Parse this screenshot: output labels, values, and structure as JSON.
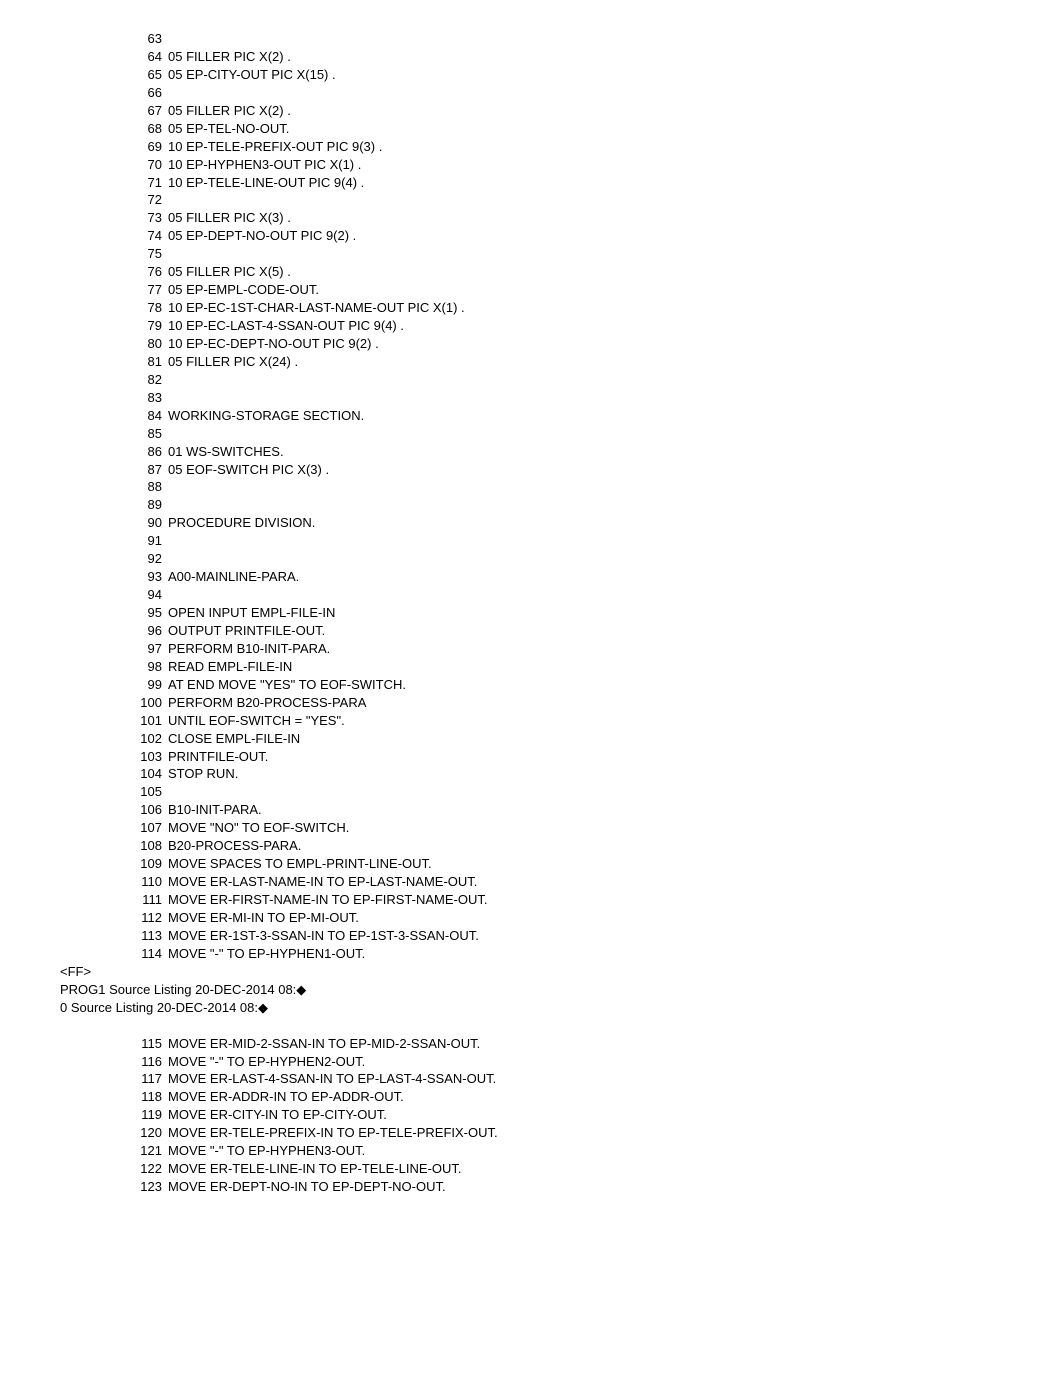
{
  "block1": [
    {
      "n": "63",
      "t": ""
    },
    {
      "n": "64",
      "t": "05 FILLER PIC X(2) ."
    },
    {
      "n": "65",
      "t": "05 EP-CITY-OUT PIC X(15) ."
    },
    {
      "n": "66",
      "t": ""
    },
    {
      "n": "67",
      "t": "05 FILLER PIC X(2) ."
    },
    {
      "n": "68",
      "t": "05 EP-TEL-NO-OUT."
    },
    {
      "n": "69",
      "t": "10 EP-TELE-PREFIX-OUT PIC 9(3) ."
    },
    {
      "n": "70",
      "t": "10 EP-HYPHEN3-OUT PIC X(1) ."
    },
    {
      "n": "71",
      "t": "10 EP-TELE-LINE-OUT PIC 9(4) ."
    },
    {
      "n": "72",
      "t": ""
    },
    {
      "n": "73",
      "t": "05 FILLER PIC X(3) ."
    },
    {
      "n": "74",
      "t": "05 EP-DEPT-NO-OUT PIC 9(2) ."
    },
    {
      "n": "75",
      "t": ""
    },
    {
      "n": "76",
      "t": "05 FILLER PIC X(5) ."
    },
    {
      "n": "77",
      "t": "05 EP-EMPL-CODE-OUT."
    },
    {
      "n": "78",
      "t": "10 EP-EC-1ST-CHAR-LAST-NAME-OUT PIC X(1) ."
    },
    {
      "n": "79",
      "t": "10 EP-EC-LAST-4-SSAN-OUT PIC 9(4) ."
    },
    {
      "n": "80",
      "t": "10 EP-EC-DEPT-NO-OUT PIC 9(2) ."
    },
    {
      "n": "81",
      "t": "05 FILLER PIC X(24) ."
    },
    {
      "n": "82",
      "t": ""
    },
    {
      "n": "83",
      "t": ""
    },
    {
      "n": "84",
      "t": "WORKING-STORAGE SECTION."
    },
    {
      "n": "85",
      "t": ""
    },
    {
      "n": "86",
      "t": "01 WS-SWITCHES."
    },
    {
      "n": "87",
      "t": "05 EOF-SWITCH PIC X(3) ."
    },
    {
      "n": "88",
      "t": ""
    },
    {
      "n": "89",
      "t": ""
    },
    {
      "n": "90",
      "t": "PROCEDURE DIVISION."
    },
    {
      "n": "91",
      "t": ""
    },
    {
      "n": "92",
      "t": ""
    },
    {
      "n": "93",
      "t": "A00-MAINLINE-PARA."
    },
    {
      "n": "94",
      "t": ""
    },
    {
      "n": "95",
      "t": "OPEN INPUT EMPL-FILE-IN"
    },
    {
      "n": "96",
      "t": "OUTPUT PRINTFILE-OUT."
    },
    {
      "n": "97",
      "t": "PERFORM B10-INIT-PARA."
    },
    {
      "n": "98",
      "t": "READ EMPL-FILE-IN"
    },
    {
      "n": "99",
      "t": "AT END MOVE \"YES\" TO EOF-SWITCH."
    },
    {
      "n": "100",
      "t": "PERFORM B20-PROCESS-PARA"
    },
    {
      "n": "101",
      "t": "UNTIL EOF-SWITCH = \"YES\"."
    },
    {
      "n": "102",
      "t": "CLOSE EMPL-FILE-IN"
    },
    {
      "n": "103",
      "t": "PRINTFILE-OUT."
    },
    {
      "n": "104",
      "t": "STOP RUN."
    },
    {
      "n": "105",
      "t": ""
    },
    {
      "n": "106",
      "t": "B10-INIT-PARA."
    },
    {
      "n": "107",
      "t": "MOVE \"NO\" TO EOF-SWITCH."
    },
    {
      "n": "108",
      "t": "B20-PROCESS-PARA."
    },
    {
      "n": "109",
      "t": "MOVE SPACES TO EMPL-PRINT-LINE-OUT."
    },
    {
      "n": "110",
      "t": "MOVE ER-LAST-NAME-IN TO EP-LAST-NAME-OUT."
    },
    {
      "n": "111",
      "t": "MOVE ER-FIRST-NAME-IN TO EP-FIRST-NAME-OUT."
    },
    {
      "n": "112",
      "t": "MOVE ER-MI-IN TO EP-MI-OUT."
    },
    {
      "n": "113",
      "t": "MOVE ER-1ST-3-SSAN-IN TO EP-1ST-3-SSAN-OUT."
    },
    {
      "n": "114",
      "t": "MOVE \"-\" TO EP-HYPHEN1-OUT."
    }
  ],
  "ff": "<FF>",
  "header1": "PROG1 Source Listing 20-DEC-2014 08:◆",
  "header2": "0 Source Listing 20-DEC-2014 08:◆",
  "block2": [
    {
      "n": "115",
      "t": "MOVE ER-MID-2-SSAN-IN TO EP-MID-2-SSAN-OUT."
    },
    {
      "n": "116",
      "t": "MOVE \"-\" TO EP-HYPHEN2-OUT."
    },
    {
      "n": "117",
      "t": "MOVE ER-LAST-4-SSAN-IN TO EP-LAST-4-SSAN-OUT."
    },
    {
      "n": "118",
      "t": "MOVE ER-ADDR-IN TO EP-ADDR-OUT."
    },
    {
      "n": "119",
      "t": "MOVE ER-CITY-IN TO EP-CITY-OUT."
    },
    {
      "n": "120",
      "t": "MOVE ER-TELE-PREFIX-IN TO EP-TELE-PREFIX-OUT."
    },
    {
      "n": "121",
      "t": "MOVE \"-\" TO EP-HYPHEN3-OUT."
    },
    {
      "n": "122",
      "t": "MOVE ER-TELE-LINE-IN TO EP-TELE-LINE-OUT."
    },
    {
      "n": "123",
      "t": "MOVE ER-DEPT-NO-IN TO EP-DEPT-NO-OUT."
    }
  ]
}
